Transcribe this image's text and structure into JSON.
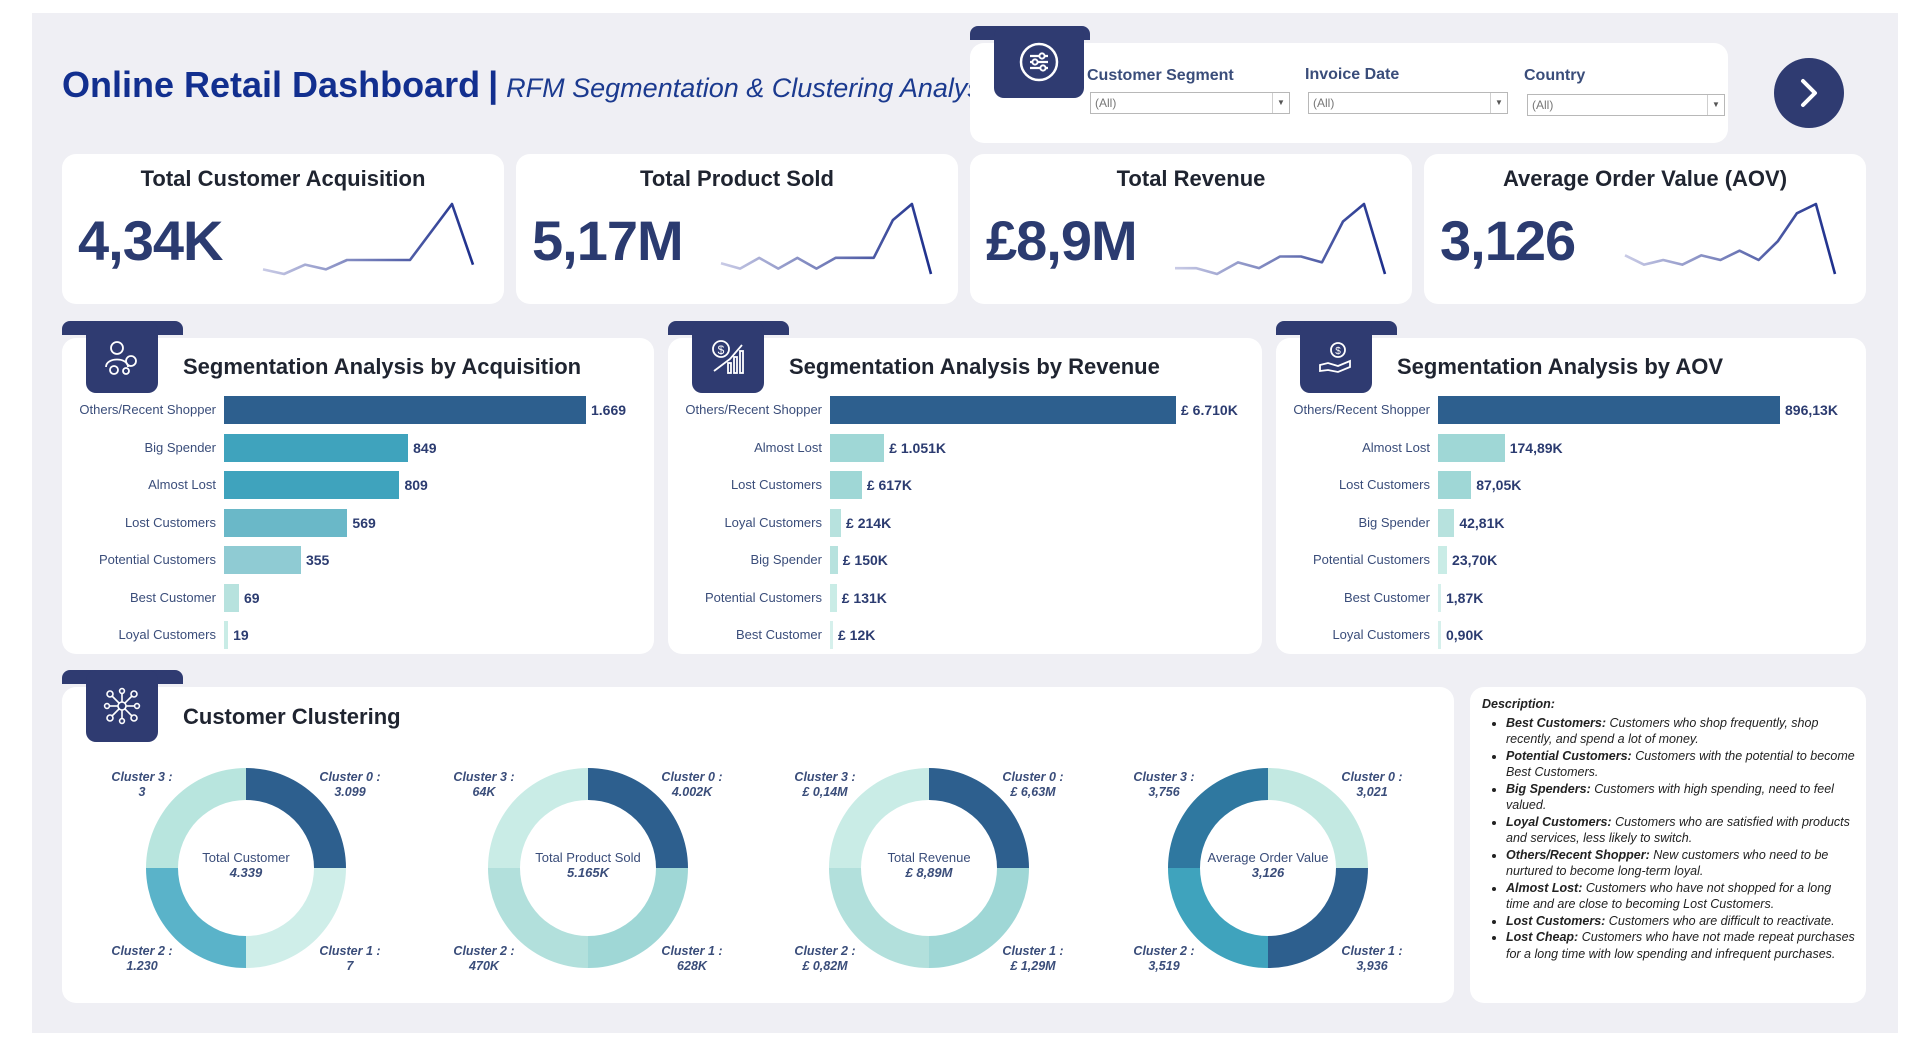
{
  "header": {
    "title": "Online Retail Dashboard",
    "separator": "|",
    "subtitle": "RFM Segmentation & Clustering Analysis"
  },
  "filters": [
    {
      "label": "Customer Segment",
      "value": "(All)"
    },
    {
      "label": "Invoice Date",
      "value": "(All)"
    },
    {
      "label": "Country",
      "value": "(All)"
    }
  ],
  "kpis": [
    {
      "title": "Total Customer Acquisition",
      "value": "4,34K",
      "trend": [
        4,
        3,
        5,
        4,
        6,
        6,
        6,
        6,
        12,
        18,
        5
      ]
    },
    {
      "title": "Total Product Sold",
      "value": "5,17M",
      "trend": [
        6,
        5,
        7,
        5,
        7,
        5,
        7,
        7,
        7,
        14,
        17,
        4
      ]
    },
    {
      "title": "Total Revenue",
      "value": "£8,9M",
      "trend": [
        6,
        6,
        5,
        7,
        6,
        8,
        8,
        7,
        14,
        17,
        5
      ]
    },
    {
      "title": "Average Order Value (AOV)",
      "value": "3,126",
      "trend": [
        6,
        4,
        5,
        4,
        6,
        5,
        7,
        5,
        9,
        15,
        17,
        2
      ]
    }
  ],
  "colors": {
    "navy": "#2b3b70",
    "dark_bar": "#2d5f8e",
    "teal": "#3fa3bd",
    "light_teal": "#9fd7d6",
    "pale": "#cfeee9"
  },
  "segments": [
    {
      "title": "Segmentation Analysis by Acquisition",
      "icon": "users-icon",
      "rows": [
        {
          "category": "Others/Recent Shopper",
          "value": 1669,
          "label": "1.669",
          "color": "#2d5f8e"
        },
        {
          "category": "Big Spender",
          "value": 849,
          "label": "849",
          "color": "#3fa3bd"
        },
        {
          "category": "Almost Lost",
          "value": 809,
          "label": "809",
          "color": "#3fa3bd"
        },
        {
          "category": "Lost Customers",
          "value": 569,
          "label": "569",
          "color": "#6ab8c8"
        },
        {
          "category": "Potential Customers",
          "value": 355,
          "label": "355",
          "color": "#8fcbd3"
        },
        {
          "category": "Best Customer",
          "value": 69,
          "label": "69",
          "color": "#b7e2de"
        },
        {
          "category": "Loyal Customers",
          "value": 19,
          "label": "19",
          "color": "#c9ece6"
        }
      ]
    },
    {
      "title": "Segmentation Analysis by Revenue",
      "icon": "money-chart-icon",
      "rows": [
        {
          "category": "Others/Recent Shopper",
          "value": 6710,
          "label": "£ 6.710K",
          "color": "#2d5f8e"
        },
        {
          "category": "Almost Lost",
          "value": 1051,
          "label": "£ 1.051K",
          "color": "#9fd7d6"
        },
        {
          "category": "Lost Customers",
          "value": 617,
          "label": "£ 617K",
          "color": "#9fd7d6"
        },
        {
          "category": "Loyal Customers",
          "value": 214,
          "label": "£ 214K",
          "color": "#b7e2de"
        },
        {
          "category": "Big Spender",
          "value": 150,
          "label": "£ 150K",
          "color": "#b7e2de"
        },
        {
          "category": "Potential Customers",
          "value": 131,
          "label": "£ 131K",
          "color": "#c9ece6"
        },
        {
          "category": "Best Customer",
          "value": 12,
          "label": "£ 12K",
          "color": "#d6f0ec"
        }
      ]
    },
    {
      "title": "Segmentation Analysis by AOV",
      "icon": "hand-coin-icon",
      "rows": [
        {
          "category": "Others/Recent Shopper",
          "value": 896.13,
          "label": "896,13K",
          "color": "#2d5f8e"
        },
        {
          "category": "Almost Lost",
          "value": 174.89,
          "label": "174,89K",
          "color": "#9fd7d6"
        },
        {
          "category": "Lost Customers",
          "value": 87.05,
          "label": "87,05K",
          "color": "#9fd7d6"
        },
        {
          "category": "Big Spender",
          "value": 42.81,
          "label": "42,81K",
          "color": "#b7e2de"
        },
        {
          "category": "Potential Customers",
          "value": 23.7,
          "label": "23,70K",
          "color": "#c9ece6"
        },
        {
          "category": "Best Customer",
          "value": 1.87,
          "label": "1,87K",
          "color": "#d6f0ec"
        },
        {
          "category": "Loyal Customers",
          "value": 0.9,
          "label": "0,90K",
          "color": "#d6f0ec"
        }
      ]
    }
  ],
  "clustering": {
    "title": "Customer Clustering",
    "donuts": [
      {
        "center_title": "Total Customer",
        "center_value": "4.339",
        "slices": [
          {
            "name": "Cluster 0 :",
            "value": 3099,
            "label": "3.099",
            "color": "#2d5f8e"
          },
          {
            "name": "Cluster 1 :",
            "value": 7,
            "label": "7",
            "color": "#cfeee9"
          },
          {
            "name": "Cluster 2 :",
            "value": 1230,
            "label": "1.230",
            "color": "#5ab3c9"
          },
          {
            "name": "Cluster 3 :",
            "value": 3,
            "label": "3",
            "color": "#b8e5de"
          }
        ]
      },
      {
        "center_title": "Total Product Sold",
        "center_value": "5.165K",
        "slices": [
          {
            "name": "Cluster 0 :",
            "value": 4002,
            "label": "4.002K",
            "color": "#2d5f8e"
          },
          {
            "name": "Cluster 1 :",
            "value": 628,
            "label": "628K",
            "color": "#9fd7d6"
          },
          {
            "name": "Cluster 2 :",
            "value": 470,
            "label": "470K",
            "color": "#b2e0dc"
          },
          {
            "name": "Cluster 3 :",
            "value": 64,
            "label": "64K",
            "color": "#c9ece6"
          }
        ]
      },
      {
        "center_title": "Total Revenue",
        "center_value": "£ 8,89M",
        "slices": [
          {
            "name": "Cluster 0 :",
            "value": 6.63,
            "label": "£ 6,63M",
            "color": "#2d5f8e"
          },
          {
            "name": "Cluster 1 :",
            "value": 1.29,
            "label": "£ 1,29M",
            "color": "#9fd7d6"
          },
          {
            "name": "Cluster 2 :",
            "value": 0.82,
            "label": "£ 0,82M",
            "color": "#b2e0dc"
          },
          {
            "name": "Cluster 3 :",
            "value": 0.14,
            "label": "£ 0,14M",
            "color": "#c9ece6"
          }
        ]
      },
      {
        "center_title": "Average Order Value",
        "center_value": "3,126",
        "slices": [
          {
            "name": "Cluster 0 :",
            "value": 3.021,
            "label": "3,021",
            "color": "#c3e9e2"
          },
          {
            "name": "Cluster 1 :",
            "value": 3.936,
            "label": "3,936",
            "color": "#2d5f8e"
          },
          {
            "name": "Cluster 2 :",
            "value": 3.519,
            "label": "3,519",
            "color": "#3fa3bd"
          },
          {
            "name": "Cluster 3 :",
            "value": 3.756,
            "label": "3,756",
            "color": "#2f78a0"
          }
        ]
      }
    ]
  },
  "description": {
    "heading": "Description:",
    "items": [
      {
        "term": "Best Customers:",
        "text": "Customers who shop frequently, shop recently, and spend a lot of money."
      },
      {
        "term": "Potential Customers:",
        "text": "Customers with the potential to become Best Customers."
      },
      {
        "term": "Big Spenders:",
        "text": "Customers with high spending, need to feel valued."
      },
      {
        "term": "Loyal Customers:",
        "text": "Customers who are satisfied with products and services, less likely to switch."
      },
      {
        "term": "Others/Recent Shopper:",
        "text": "New customers who need to be nurtured to become long-term loyal."
      },
      {
        "term": "Almost Lost:",
        "text": "Customers who have not shopped for a long time and are close to becoming Lost Customers."
      },
      {
        "term": "Lost Customers:",
        "text": "Customers who are difficult to reactivate."
      },
      {
        "term": "Lost Cheap:",
        "text": "Customers who have not made repeat purchases for a long time with low spending and infrequent purchases."
      }
    ]
  }
}
